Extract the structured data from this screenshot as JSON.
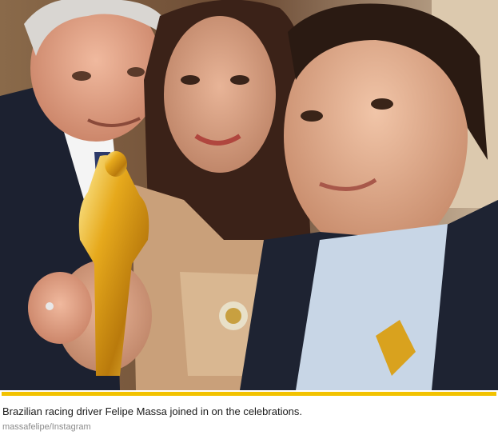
{
  "figure": {
    "caption": "Brazilian racing driver Felipe Massa joined in on the celebrations.",
    "credit": "massafelipe/Instagram",
    "accent_color": "#f2c200",
    "photo_icon": "photo-selfie"
  }
}
